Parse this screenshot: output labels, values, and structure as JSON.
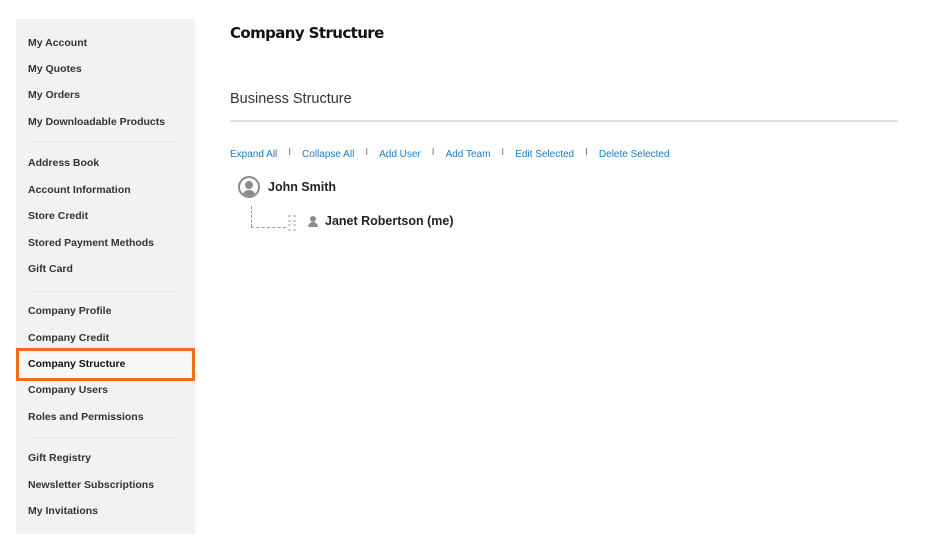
{
  "sidebar": {
    "groups": [
      {
        "items": [
          {
            "label": "My Account"
          },
          {
            "label": "My Quotes"
          },
          {
            "label": "My Orders"
          },
          {
            "label": "My Downloadable Products"
          }
        ]
      },
      {
        "items": [
          {
            "label": "Address Book"
          },
          {
            "label": "Account Information"
          },
          {
            "label": "Store Credit"
          },
          {
            "label": "Stored Payment Methods"
          },
          {
            "label": "Gift Card"
          }
        ]
      },
      {
        "items": [
          {
            "label": "Company Profile"
          },
          {
            "label": "Company Credit"
          },
          {
            "label": "Company Structure",
            "active": true
          },
          {
            "label": "Company Users"
          },
          {
            "label": "Roles and Permissions"
          }
        ]
      },
      {
        "items": [
          {
            "label": "Gift Registry"
          },
          {
            "label": "Newsletter Subscriptions"
          },
          {
            "label": "My Invitations"
          }
        ]
      }
    ],
    "highlight_color": "#f26a1b"
  },
  "main": {
    "page_title": "Company Structure",
    "section_title": "Business Structure",
    "actions": [
      {
        "label": "Expand All"
      },
      {
        "label": "Collapse All"
      },
      {
        "label": "Add User"
      },
      {
        "label": "Add Team"
      },
      {
        "label": "Edit Selected"
      },
      {
        "label": "Delete Selected"
      }
    ],
    "action_separator": "I",
    "link_color": "#1979c3",
    "tree": {
      "root": {
        "name": "John Smith",
        "icon": "user-circle-icon"
      },
      "children": [
        {
          "name": "Janet Robertson (me)",
          "icon": "user-icon"
        }
      ]
    }
  }
}
